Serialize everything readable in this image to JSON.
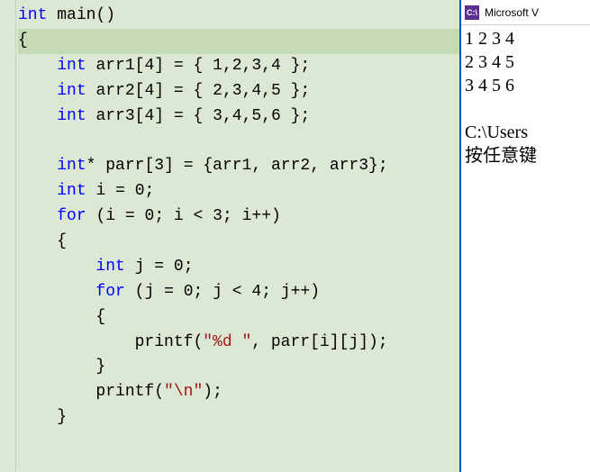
{
  "editor": {
    "lines": [
      {
        "indent": 0,
        "tokens": [
          [
            "kw",
            "int"
          ],
          [
            "sp",
            " "
          ],
          [
            "id",
            "main"
          ],
          [
            "punct",
            "()"
          ]
        ]
      },
      {
        "indent": 0,
        "highlight": true,
        "tokens": [
          [
            "punct",
            "{"
          ]
        ]
      },
      {
        "indent": 1,
        "tokens": [
          [
            "kw",
            "int"
          ],
          [
            "sp",
            " "
          ],
          [
            "id",
            "arr1"
          ],
          [
            "punct",
            "["
          ],
          [
            "num",
            "4"
          ],
          [
            "punct",
            "]"
          ],
          [
            "sp",
            " "
          ],
          [
            "punct",
            "="
          ],
          [
            "sp",
            " "
          ],
          [
            "punct",
            "{ "
          ],
          [
            "num",
            "1"
          ],
          [
            "punct",
            ","
          ],
          [
            "num",
            "2"
          ],
          [
            "punct",
            ","
          ],
          [
            "num",
            "3"
          ],
          [
            "punct",
            ","
          ],
          [
            "num",
            "4"
          ],
          [
            "punct",
            " };"
          ]
        ]
      },
      {
        "indent": 1,
        "tokens": [
          [
            "kw",
            "int"
          ],
          [
            "sp",
            " "
          ],
          [
            "id",
            "arr2"
          ],
          [
            "punct",
            "["
          ],
          [
            "num",
            "4"
          ],
          [
            "punct",
            "]"
          ],
          [
            "sp",
            " "
          ],
          [
            "punct",
            "="
          ],
          [
            "sp",
            " "
          ],
          [
            "punct",
            "{ "
          ],
          [
            "num",
            "2"
          ],
          [
            "punct",
            ","
          ],
          [
            "num",
            "3"
          ],
          [
            "punct",
            ","
          ],
          [
            "num",
            "4"
          ],
          [
            "punct",
            ","
          ],
          [
            "num",
            "5"
          ],
          [
            "punct",
            " };"
          ]
        ]
      },
      {
        "indent": 1,
        "tokens": [
          [
            "kw",
            "int"
          ],
          [
            "sp",
            " "
          ],
          [
            "id",
            "arr3"
          ],
          [
            "punct",
            "["
          ],
          [
            "num",
            "4"
          ],
          [
            "punct",
            "]"
          ],
          [
            "sp",
            " "
          ],
          [
            "punct",
            "="
          ],
          [
            "sp",
            " "
          ],
          [
            "punct",
            "{ "
          ],
          [
            "num",
            "3"
          ],
          [
            "punct",
            ","
          ],
          [
            "num",
            "4"
          ],
          [
            "punct",
            ","
          ],
          [
            "num",
            "5"
          ],
          [
            "punct",
            ","
          ],
          [
            "num",
            "6"
          ],
          [
            "punct",
            " };"
          ]
        ]
      },
      {
        "indent": 0,
        "tokens": []
      },
      {
        "indent": 1,
        "tokens": [
          [
            "kw",
            "int"
          ],
          [
            "punct",
            "*"
          ],
          [
            "sp",
            " "
          ],
          [
            "id",
            "parr"
          ],
          [
            "punct",
            "["
          ],
          [
            "num",
            "3"
          ],
          [
            "punct",
            "]"
          ],
          [
            "sp",
            " "
          ],
          [
            "punct",
            "="
          ],
          [
            "sp",
            " "
          ],
          [
            "punct",
            "{"
          ],
          [
            "id",
            "arr1"
          ],
          [
            "punct",
            ", "
          ],
          [
            "id",
            "arr2"
          ],
          [
            "punct",
            ", "
          ],
          [
            "id",
            "arr3"
          ],
          [
            "punct",
            "};"
          ]
        ]
      },
      {
        "indent": 1,
        "tokens": [
          [
            "kw",
            "int"
          ],
          [
            "sp",
            " "
          ],
          [
            "id",
            "i"
          ],
          [
            "sp",
            " "
          ],
          [
            "punct",
            "="
          ],
          [
            "sp",
            " "
          ],
          [
            "num",
            "0"
          ],
          [
            "punct",
            ";"
          ]
        ]
      },
      {
        "indent": 1,
        "tokens": [
          [
            "kw",
            "for"
          ],
          [
            "sp",
            " "
          ],
          [
            "punct",
            "("
          ],
          [
            "id",
            "i"
          ],
          [
            "sp",
            " "
          ],
          [
            "punct",
            "="
          ],
          [
            "sp",
            " "
          ],
          [
            "num",
            "0"
          ],
          [
            "punct",
            "; "
          ],
          [
            "id",
            "i"
          ],
          [
            "sp",
            " "
          ],
          [
            "punct",
            "<"
          ],
          [
            "sp",
            " "
          ],
          [
            "num",
            "3"
          ],
          [
            "punct",
            "; "
          ],
          [
            "id",
            "i"
          ],
          [
            "punct",
            "++)"
          ]
        ]
      },
      {
        "indent": 1,
        "tokens": [
          [
            "punct",
            "{"
          ]
        ]
      },
      {
        "indent": 2,
        "tokens": [
          [
            "kw",
            "int"
          ],
          [
            "sp",
            " "
          ],
          [
            "id",
            "j"
          ],
          [
            "sp",
            " "
          ],
          [
            "punct",
            "="
          ],
          [
            "sp",
            " "
          ],
          [
            "num",
            "0"
          ],
          [
            "punct",
            ";"
          ]
        ]
      },
      {
        "indent": 2,
        "tokens": [
          [
            "kw",
            "for"
          ],
          [
            "sp",
            " "
          ],
          [
            "punct",
            "("
          ],
          [
            "id",
            "j"
          ],
          [
            "sp",
            " "
          ],
          [
            "punct",
            "="
          ],
          [
            "sp",
            " "
          ],
          [
            "num",
            "0"
          ],
          [
            "punct",
            "; "
          ],
          [
            "id",
            "j"
          ],
          [
            "sp",
            " "
          ],
          [
            "punct",
            "<"
          ],
          [
            "sp",
            " "
          ],
          [
            "num",
            "4"
          ],
          [
            "punct",
            "; "
          ],
          [
            "id",
            "j"
          ],
          [
            "punct",
            "++)"
          ]
        ]
      },
      {
        "indent": 2,
        "tokens": [
          [
            "punct",
            "{"
          ]
        ]
      },
      {
        "indent": 3,
        "tokens": [
          [
            "call",
            "printf"
          ],
          [
            "punct",
            "("
          ],
          [
            "str",
            "\"%d \""
          ],
          [
            "punct",
            ", "
          ],
          [
            "id",
            "parr"
          ],
          [
            "punct",
            "["
          ],
          [
            "id",
            "i"
          ],
          [
            "punct",
            "]["
          ],
          [
            "id",
            "j"
          ],
          [
            "punct",
            "]);"
          ]
        ]
      },
      {
        "indent": 2,
        "tokens": [
          [
            "punct",
            "}"
          ]
        ]
      },
      {
        "indent": 2,
        "tokens": [
          [
            "call",
            "printf"
          ],
          [
            "punct",
            "("
          ],
          [
            "str",
            "\"\\n\""
          ],
          [
            "punct",
            ");"
          ]
        ]
      },
      {
        "indent": 1,
        "tokens": [
          [
            "punct",
            "}"
          ]
        ]
      }
    ]
  },
  "console": {
    "title_icon": "C:\\",
    "title": "Microsoft V",
    "output_lines": [
      "1 2 3 4",
      "2 3 4 5",
      "3 4 5 6",
      "",
      "C:\\Users",
      "按任意键"
    ]
  }
}
